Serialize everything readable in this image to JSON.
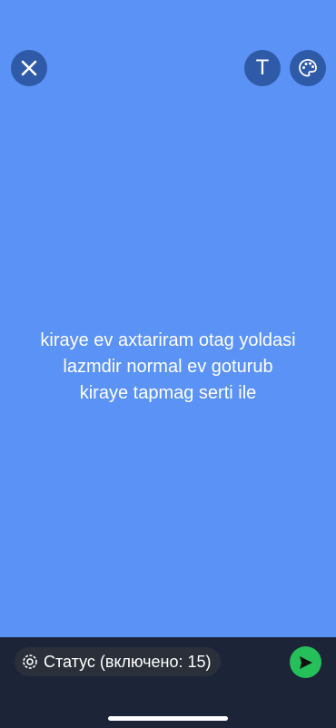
{
  "editor": {
    "background_color": "#5b92f5",
    "status_lines": [
      "kiraye ev axtariram otag yoldasi",
      "lazmdir normal ev goturub",
      "kiraye tapmag serti ile"
    ]
  },
  "toolbar": {
    "close_icon": "close-icon",
    "text_tool_label": "T",
    "palette_icon": "palette-icon"
  },
  "footer": {
    "privacy_label": "Статус (включено: 15)",
    "privacy_icon": "status-privacy-icon",
    "send_icon": "send-icon",
    "send_color": "#25c05a"
  }
}
